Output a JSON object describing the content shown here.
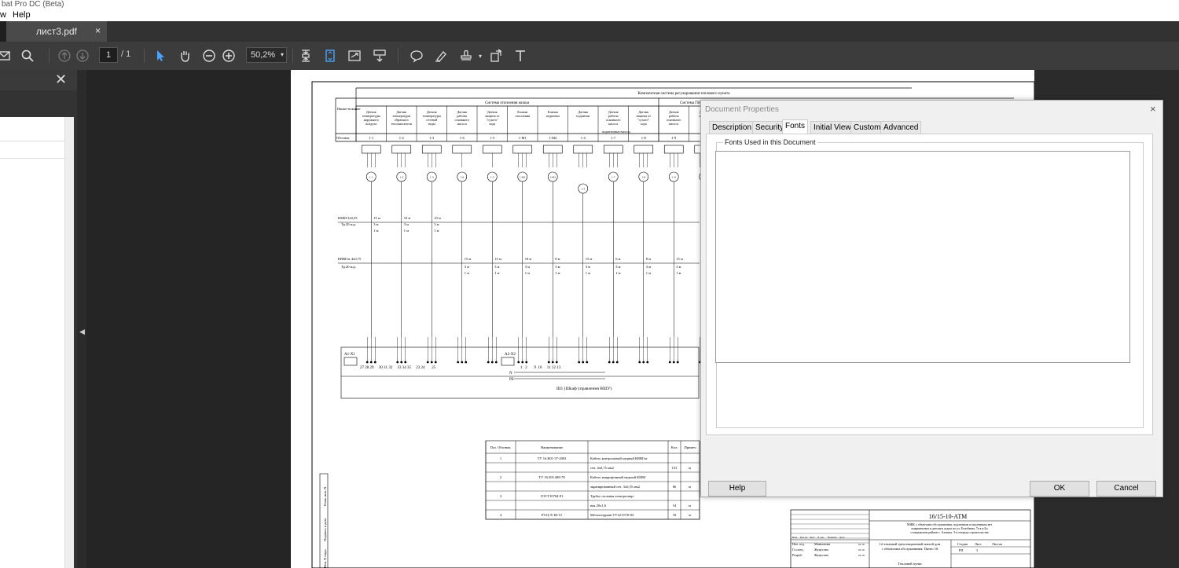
{
  "app": {
    "title": "bat Pro DC (Beta)"
  },
  "menu": {
    "items": [
      "w",
      "Help"
    ]
  },
  "tabs": [
    {
      "label": "лист3.pdf",
      "close": "×"
    }
  ],
  "toolbar": {
    "page_current": "1",
    "page_total": "/ 1",
    "zoom": "50,2%",
    "zoom_caret": "▾"
  },
  "side_panel": {
    "close": "✕"
  },
  "collapse_arrow": "◀",
  "drawing": {
    "header_main": "Комплектная система регулирования теплового пункта",
    "header_heating": "Система отопления жилья",
    "header_dhw": "Система ГВС жилья",
    "row_name": "Наиме-нование",
    "row_designation": "Обознач.",
    "columns": [
      {
        "name": "Датчик температуры наружного воздуха",
        "tag": "1-1"
      },
      {
        "name": "Датчик температуры обратного теплоносителя",
        "tag": "1-2"
      },
      {
        "name": "Датчик температуры сетевой воды",
        "tag": "1-3"
      },
      {
        "name": "Датчик работы основного насоса",
        "tag": "1-6"
      },
      {
        "name": "Датчик защиты от \"сухого\" хода",
        "tag": "1-5"
      },
      {
        "name": "Клапан отопления",
        "tag": "1-М1"
      },
      {
        "name": "Клапан подпитки",
        "tag": "1-М2"
      },
      {
        "name": "Датчик подпитки",
        "tag": "1-4"
      },
      {
        "name": "Датчик работы основного насоса",
        "tag": "1-7"
      },
      {
        "name": "Датчик защиты от \"сухого\" хода",
        "tag": "1-8"
      },
      {
        "name": "Датчик работы основного насоса",
        "tag": "1-9"
      },
      {
        "name": "Датчик защиты",
        "tag": "1-10"
      }
    ],
    "cable1": "КММ 3х0,35",
    "cable2": "КВВГнг 4х0,75",
    "pipe1": "Тр.20 м.р.",
    "pipe2": "Тр.20 м.р.",
    "pump_note": "подпиточные насосы",
    "cabinet": "Ш1 (Шкаф управления ВШУ)",
    "terminal1": "А1-Х1",
    "terminal2": "А2-Х2",
    "terminal1_numbers": "27 28 29     30 31 32     33 34 35     23 24       25",
    "terminal2_numbers": "1   2       9  10     11 12 13",
    "bus_n": "N",
    "bus_pe": "PE",
    "cable_lengths_1": [
      "15 м",
      "10 м",
      "10 м"
    ],
    "cable_lengths_2": [
      "15 м",
      "15 м",
      "10 м",
      "8 м",
      "15 м",
      "6 м",
      "8 м",
      "15 м"
    ],
    "pipe_lengths": [
      "3 м",
      "1 м"
    ],
    "spec_headers": [
      "Поз. Обознач.",
      "Наименование",
      "Кол.",
      "Примеч"
    ],
    "spec_rows": [
      {
        "pos": "1",
        "code": "ТУ 16.К01-37-2003",
        "desc": "Кабель контрольный медный КВВГнг",
        "qty": "",
        "unit": ""
      },
      {
        "pos": "",
        "code": "",
        "desc": "сеч. 4х0,75 мм2",
        "qty": "153",
        "unit": "м"
      },
      {
        "pos": "2",
        "code": "ТУ 16.505.488-78",
        "desc": "Кабель микрофонный медный КММ",
        "qty": "",
        "unit": ""
      },
      {
        "pos": "",
        "code": "",
        "desc": "экранированный сеч. 3х0,35 мм2",
        "qty": "66",
        "unit": "м"
      },
      {
        "pos": "3",
        "code": "ГОСТ10704-91",
        "desc": "Трубы стальная электросвар-",
        "qty": "",
        "unit": ""
      },
      {
        "pos": "",
        "code": "",
        "desc": "ная 20х1,6",
        "qty": "54",
        "unit": "м"
      },
      {
        "pos": "4",
        "code": "РЗ-Ц-Х-Ш-15",
        "desc": "Металлорукав ТУ22.5570-83",
        "qty": "18",
        "unit": "м"
      }
    ],
    "stamp_code": "16/15-10-АТМ",
    "stamp_project": "МЖК с объектами обслуживания, подземным и надземным автопаркингами и детским садом по ул. Егизбаева, 7а в в Бостандыкском районе г. Алматы. 3-я очередь строительства",
    "stamp_building": "12-этажный трехсекционный жилой дом с объектами обслуживания. Пятно 10.",
    "stamp_sheet_title": "Тепловой пункт.",
    "stamp_stage_headers": [
      "Стадия",
      "Лист",
      "Листов"
    ],
    "stamp_stage_values": [
      "РП",
      "3",
      ""
    ],
    "stamp_roles": [
      "Нач. отд.",
      "Гл.спец.",
      "Разраб."
    ],
    "stamp_names": [
      "Мамонтова",
      "Жунусова",
      "Жунусова"
    ],
    "stamp_dates": [
      "02.16",
      "02.16",
      "02.16"
    ],
    "stamp_cols": [
      "Изм.",
      "Кол.уч.",
      "Лист",
      "N док.",
      "Подпись",
      "Дата"
    ],
    "side_labels": [
      "Взам. инв. N",
      "Подпись и дата",
      "Инв. N подл."
    ]
  },
  "dialog": {
    "title": "Document Properties",
    "close": "×",
    "tabs": [
      "Description",
      "Security",
      "Fonts",
      "Initial View",
      "Custom",
      "Advanced"
    ],
    "active_tab": "Fonts",
    "group_label": "Fonts Used in this Document",
    "help": "Help",
    "ok": "OK",
    "cancel": "Cancel"
  }
}
